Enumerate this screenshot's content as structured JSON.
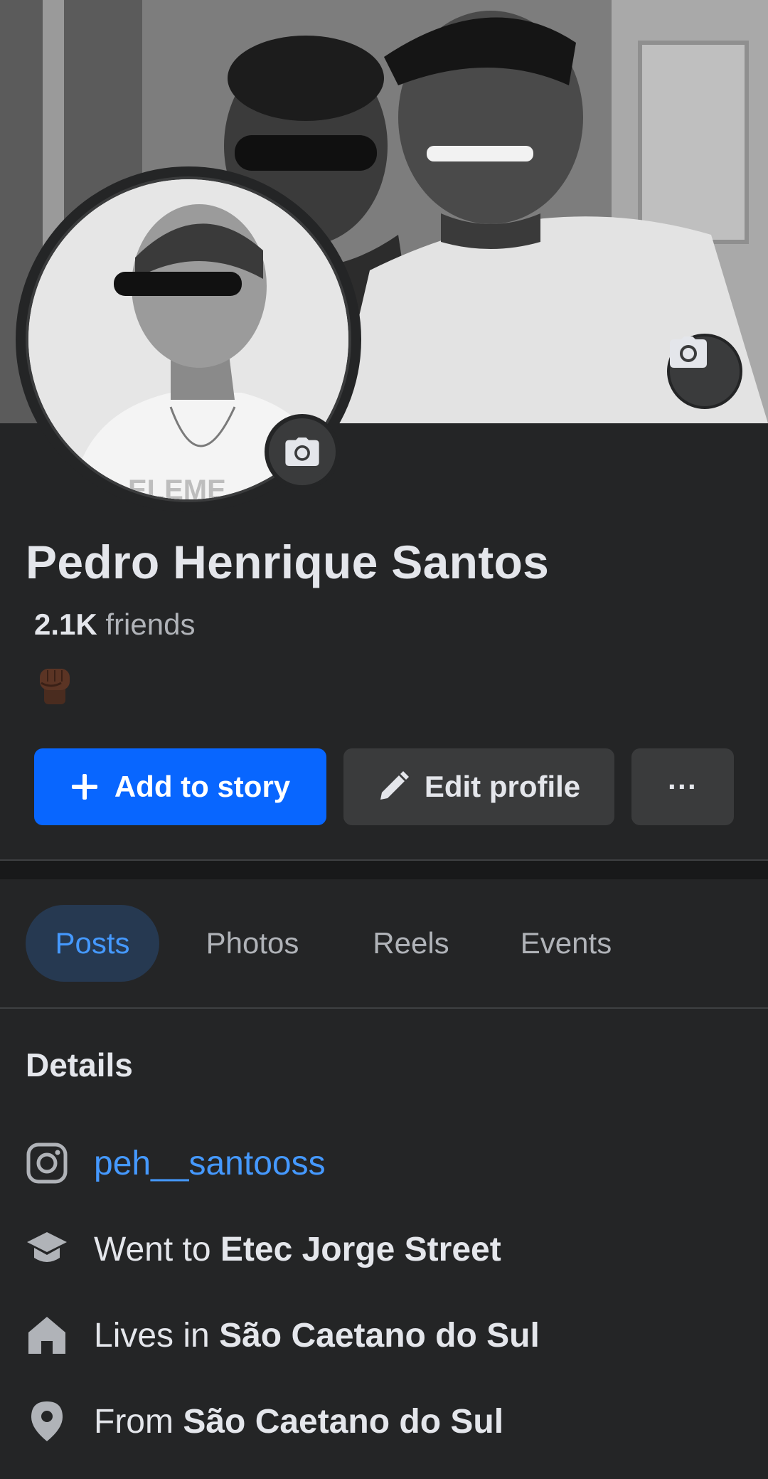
{
  "profile": {
    "name": "Pedro Henrique Santos",
    "friends_count": "2.1K",
    "friends_label": "friends",
    "bio_emoji": "raised-fist-emoji"
  },
  "actions": {
    "add_story_label": "Add to story",
    "edit_profile_label": "Edit profile",
    "more_label": "···"
  },
  "tabs": [
    {
      "label": "Posts",
      "active": true
    },
    {
      "label": "Photos",
      "active": false
    },
    {
      "label": "Reels",
      "active": false
    },
    {
      "label": "Events",
      "active": false
    }
  ],
  "details": {
    "title": "Details",
    "instagram": "peh__santooss",
    "school_prefix": "Went to",
    "school_name": "Etec Jorge Street",
    "lives_prefix": "Lives in",
    "lives_city": "São Caetano do Sul",
    "from_prefix": "From",
    "from_city": "São Caetano do Sul"
  },
  "colors": {
    "background": "#242526",
    "accent": "#0866ff",
    "link": "#4599ff",
    "secondary_button": "#3a3b3c"
  },
  "icons": {
    "cover_camera": "camera-icon",
    "avatar_camera": "camera-icon",
    "add": "plus-icon",
    "edit": "pencil-icon",
    "instagram": "instagram-icon",
    "school": "graduation-cap-icon",
    "home": "home-icon",
    "location": "location-pin-icon"
  }
}
